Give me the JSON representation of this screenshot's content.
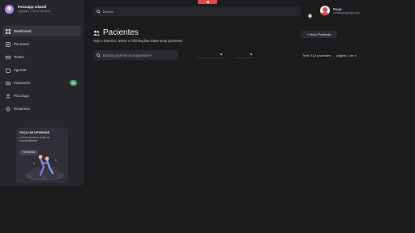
{
  "app": {
    "title": "Psicoapp Infantil",
    "subtitle": "expirado: 3 de fev de 2024"
  },
  "sidebar": {
    "items": [
      {
        "label": "Dashboard",
        "icon": "grid-icon",
        "active": true
      },
      {
        "label": "Pacientes",
        "icon": "patients-icon"
      },
      {
        "label": "Testes",
        "icon": "tests-icon"
      },
      {
        "label": "Agenda",
        "icon": "calendar-icon"
      },
      {
        "label": "Financeiro",
        "icon": "finance-icon",
        "badge": "99"
      },
      {
        "label": "Psicólogo",
        "icon": "user-icon"
      },
      {
        "label": "Relatórios",
        "icon": "reports-icon"
      }
    ]
  },
  "upgrade": {
    "title": "FAÇA UM UPGRADE",
    "text": "e tenha acesso a todas as funcionalidades",
    "button": "Ver planos"
  },
  "search": {
    "placeholder": "Buscar"
  },
  "user": {
    "name": "Regis",
    "email": "contato@regisapp.com"
  },
  "page": {
    "title": "Pacientes",
    "subtitle": "Veja o histórico, testes e informações sobre seus pacientes",
    "new_button": "+ Novo Paciente"
  },
  "filters": {
    "search_placeholder": "Buscar paciente ou responsável",
    "select_1": "",
    "select_2": ""
  },
  "pager": {
    "total": "Total: 112 pacientes",
    "page": "página 1 de 4"
  },
  "colors": {
    "background": "#1c1c1f",
    "sidebar": "#26262c",
    "badge": "#3fa56b",
    "accent_red": "#e24a4a"
  }
}
